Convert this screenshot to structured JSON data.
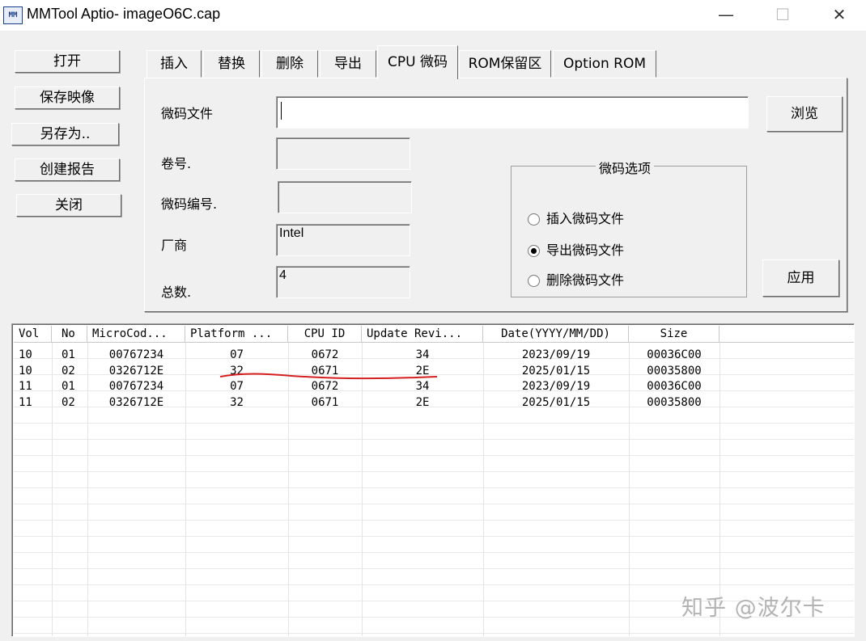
{
  "window": {
    "title": "MMTool Aptio- imageO6C.cap",
    "icon_label": "MM",
    "min": "—",
    "max": "☐",
    "close": "✕"
  },
  "side_buttons": [
    "打开",
    "保存映像",
    "另存为..",
    "创建报告",
    "关闭"
  ],
  "tabs": [
    "插入",
    "替换",
    "删除",
    "导出",
    "CPU 微码",
    "ROM保留区",
    "Option ROM"
  ],
  "active_tab": "CPU 微码",
  "form": {
    "microcode_file_label": "微码文件",
    "microcode_file_value": "",
    "browse_button": "浏览",
    "volume_label": "卷号.",
    "volume_value": "",
    "microcode_no_label": "微码编号.",
    "microcode_no_value": "",
    "vendor_label": "厂商",
    "vendor_value": "Intel",
    "total_label": "总数.",
    "total_value": "4",
    "apply_button": "应用"
  },
  "options_group": {
    "title": "微码选项",
    "options": [
      {
        "label": "插入微码文件",
        "checked": false
      },
      {
        "label": "导出微码文件",
        "checked": true
      },
      {
        "label": "删除微码文件",
        "checked": false
      }
    ]
  },
  "table": {
    "columns": [
      "Vol",
      "No",
      "MicroCod...",
      "Platform ...",
      "CPU ID",
      "Update Revi...",
      "Date(YYYY/MM/DD)",
      "Size"
    ],
    "rows": [
      [
        "10",
        "01",
        "00767234",
        "07",
        "0672",
        "34",
        "2023/09/19",
        "00036C00"
      ],
      [
        "10",
        "02",
        "0326712E",
        "32",
        "0671",
        "2E",
        "2025/01/15",
        "00035800"
      ],
      [
        "11",
        "01",
        "00767234",
        "07",
        "0672",
        "34",
        "2023/09/19",
        "00036C00"
      ],
      [
        "11",
        "02",
        "0326712E",
        "32",
        "0671",
        "2E",
        "2025/01/15",
        "00035800"
      ]
    ]
  },
  "watermark": "知乎 @波尔卡",
  "colors": {
    "annotation_line": "#d62020",
    "watermark": "#b3b3b3"
  }
}
